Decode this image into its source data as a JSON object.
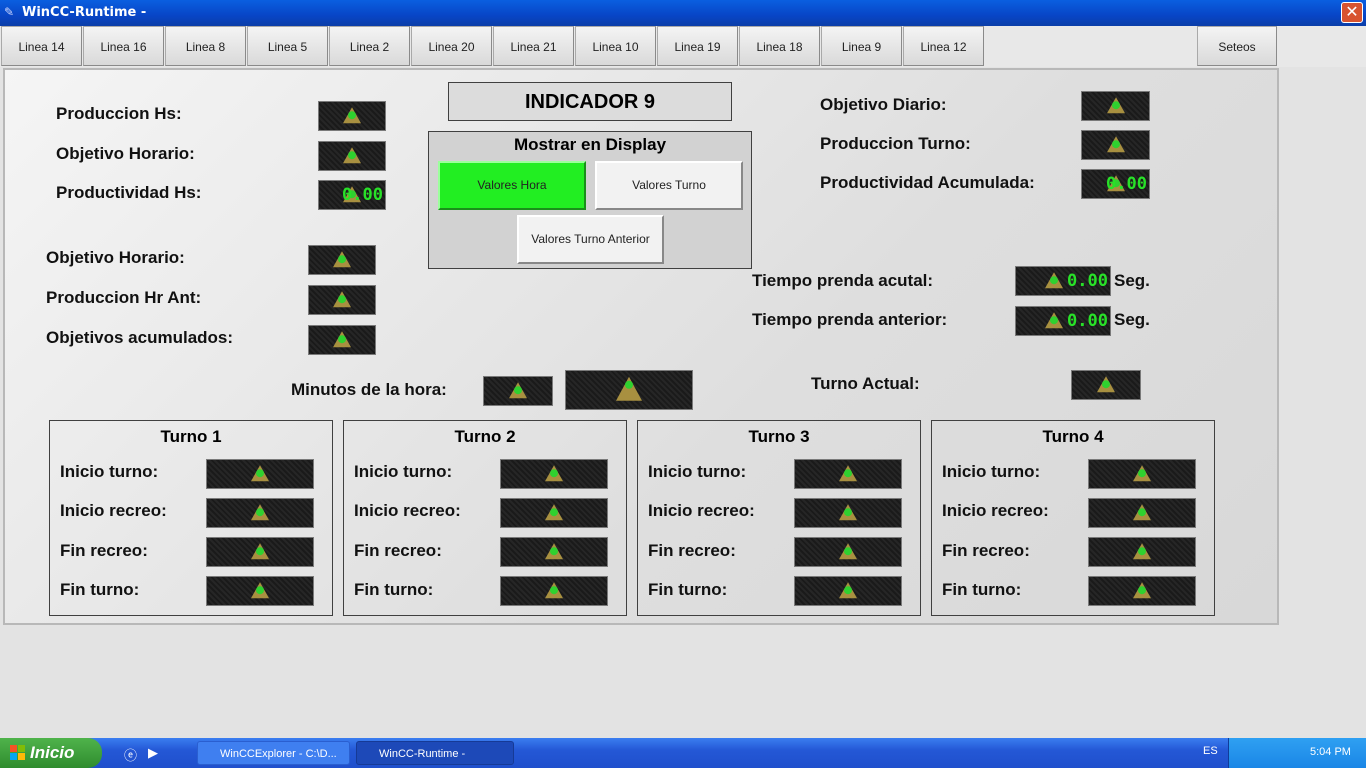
{
  "window": {
    "title": "WinCC-Runtime -",
    "close_label": "✕"
  },
  "tabs": [
    "Linea 14",
    "Linea 16",
    "Linea 8",
    "Linea 5",
    "Linea 2",
    "Linea 20",
    "Linea 21",
    "Linea 10",
    "Linea 19",
    "Linea 18",
    "Linea 9",
    "Linea 12"
  ],
  "setup_tab": "Seteos",
  "indicator_title": "INDICADOR 9",
  "left_top": {
    "produccion_hs": "Produccion Hs:",
    "objetivo_horario": "Objetivo Horario:",
    "productividad_hs": "Productividad Hs:",
    "productividad_value": "0.00"
  },
  "left_mid": {
    "objetivo_horario": "Objetivo Horario:",
    "produccion_hr_ant": "Produccion Hr Ant:",
    "objetivos_acumulados": "Objetivos acumulados:"
  },
  "display": {
    "title": "Mostrar en Display",
    "btn_hora": "Valores Hora",
    "btn_turno": "Valores Turno",
    "btn_turno_anterior": "Valores Turno Anterior"
  },
  "right_top": {
    "objetivo_diario": "Objetivo Diario:",
    "produccion_turno": "Produccion Turno:",
    "productividad_acumulada": "Productividad Acumulada:",
    "productividad_value": "0.00"
  },
  "tiempo": {
    "actual_label": "Tiempo prenda acutal:",
    "anterior_label": "Tiempo prenda anterior:",
    "actual_value": "0.00",
    "anterior_value": "0.00",
    "unit": "Seg."
  },
  "minutos_label": "Minutos de la hora:",
  "turno_actual_label": "Turno Actual:",
  "turnos": [
    {
      "title": "Turno 1",
      "inicio_turno": "Inicio turno:",
      "inicio_recreo": "Inicio recreo:",
      "fin_recreo": "Fin recreo:",
      "fin_turno": "Fin turno:"
    },
    {
      "title": "Turno 2",
      "inicio_turno": "Inicio turno:",
      "inicio_recreo": "Inicio recreo:",
      "fin_recreo": "Fin recreo:",
      "fin_turno": "Fin turno:"
    },
    {
      "title": "Turno 3",
      "inicio_turno": "Inicio turno:",
      "inicio_recreo": "Inicio recreo:",
      "fin_recreo": "Fin recreo:",
      "fin_turno": "Fin turno:"
    },
    {
      "title": "Turno 4",
      "inicio_turno": "Inicio turno:",
      "inicio_recreo": "Inicio recreo:",
      "fin_recreo": "Fin recreo:",
      "fin_turno": "Fin turno:"
    }
  ],
  "taskbar": {
    "start": "Inicio",
    "task1": "WinCCExplorer - C:\\D...",
    "task2": "WinCC-Runtime -",
    "lang": "ES",
    "time": "5:04 PM"
  },
  "colors": {
    "active_button": "#22ee22",
    "display_text": "#28e128",
    "titlebar": "#0845c6"
  },
  "icons": [
    "warning-icon",
    "close-icon",
    "windows-logo-icon"
  ]
}
